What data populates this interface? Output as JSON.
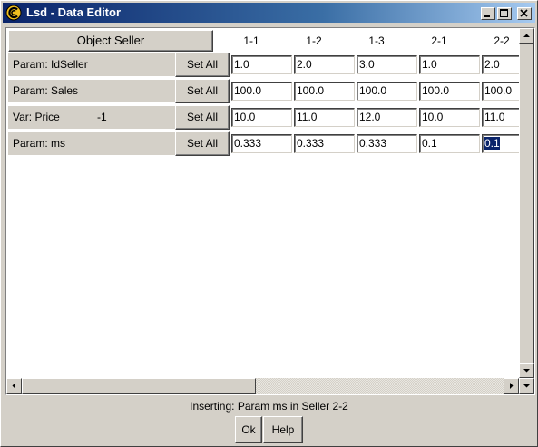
{
  "window": {
    "title": "Lsd - Data Editor",
    "app_icon": "lsd-logo-icon"
  },
  "header": {
    "object_button": "Object Seller",
    "columns": [
      "1-1",
      "1-2",
      "1-3",
      "2-1",
      "2-2"
    ]
  },
  "rows": [
    {
      "label": "Param: IdSeller",
      "lag": "",
      "setall": "Set All",
      "values": [
        "1.0",
        "2.0",
        "3.0",
        "1.0",
        "2.0"
      ]
    },
    {
      "label": "Param: Sales",
      "lag": "",
      "setall": "Set All",
      "values": [
        "100.0",
        "100.0",
        "100.0",
        "100.0",
        "100.0"
      ]
    },
    {
      "label": "Var: Price",
      "lag": "-1",
      "setall": "Set All",
      "values": [
        "10.0",
        "11.0",
        "12.0",
        "10.0",
        "11.0"
      ]
    },
    {
      "label": "Param: ms",
      "lag": "",
      "setall": "Set All",
      "values": [
        "0.333",
        "0.333",
        "0.333",
        "0.1",
        "0.1"
      ]
    }
  ],
  "status": "Inserting: Param ms in Seller 2-2",
  "buttons": {
    "ok": "Ok",
    "help": "Help"
  },
  "colors": {
    "title_start": "#0a246a",
    "title_end": "#a6caf0",
    "face": "#d4d0c8",
    "selection": "#0a246a"
  }
}
